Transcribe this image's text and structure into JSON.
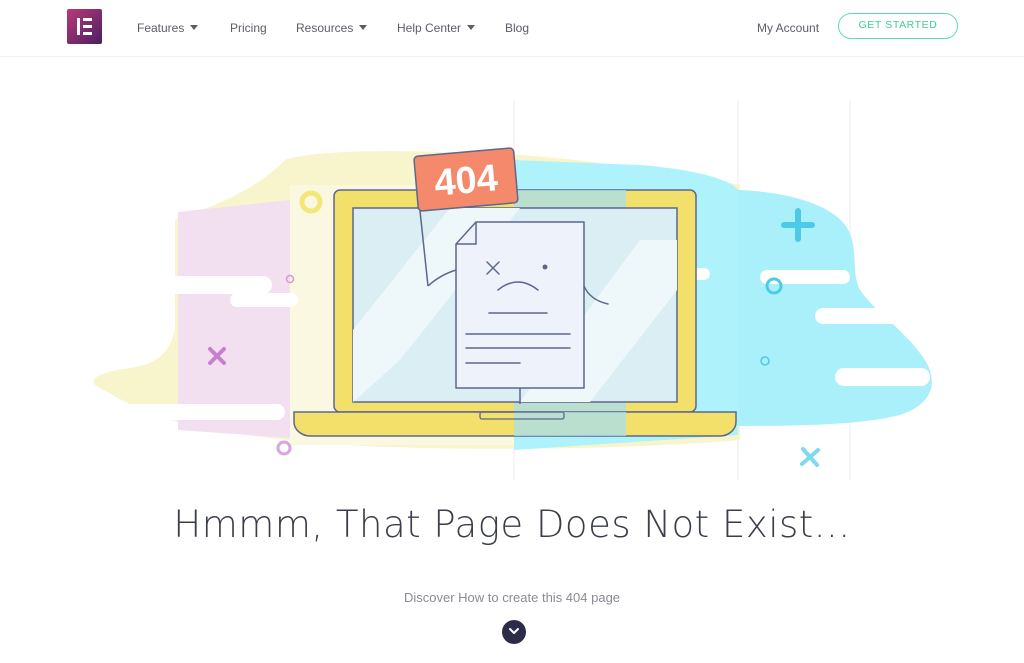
{
  "header": {
    "logo_icon": "elementor-logo-icon",
    "nav": [
      {
        "label": "Features",
        "dropdown": true
      },
      {
        "label": "Pricing",
        "dropdown": false
      },
      {
        "label": "Resources",
        "dropdown": true
      },
      {
        "label": "Help Center",
        "dropdown": true
      },
      {
        "label": "Blog",
        "dropdown": false
      }
    ],
    "account_label": "My Account",
    "cta_label": "GET STARTED"
  },
  "illustration": {
    "flag_text": "404"
  },
  "main": {
    "headline": "Hmmm, That Page Does Not Exist...",
    "subtext": "Discover How to create this 404 page",
    "scroll_icon": "chevron-down-icon"
  },
  "colors": {
    "brand": "#92003b",
    "accent_green": "#5ce0ad",
    "yellow": "#f4e77a",
    "cyan": "#a8f1fa",
    "pink": "#f1dcf2",
    "coral": "#f4896b",
    "dark": "#2d2b4a"
  }
}
